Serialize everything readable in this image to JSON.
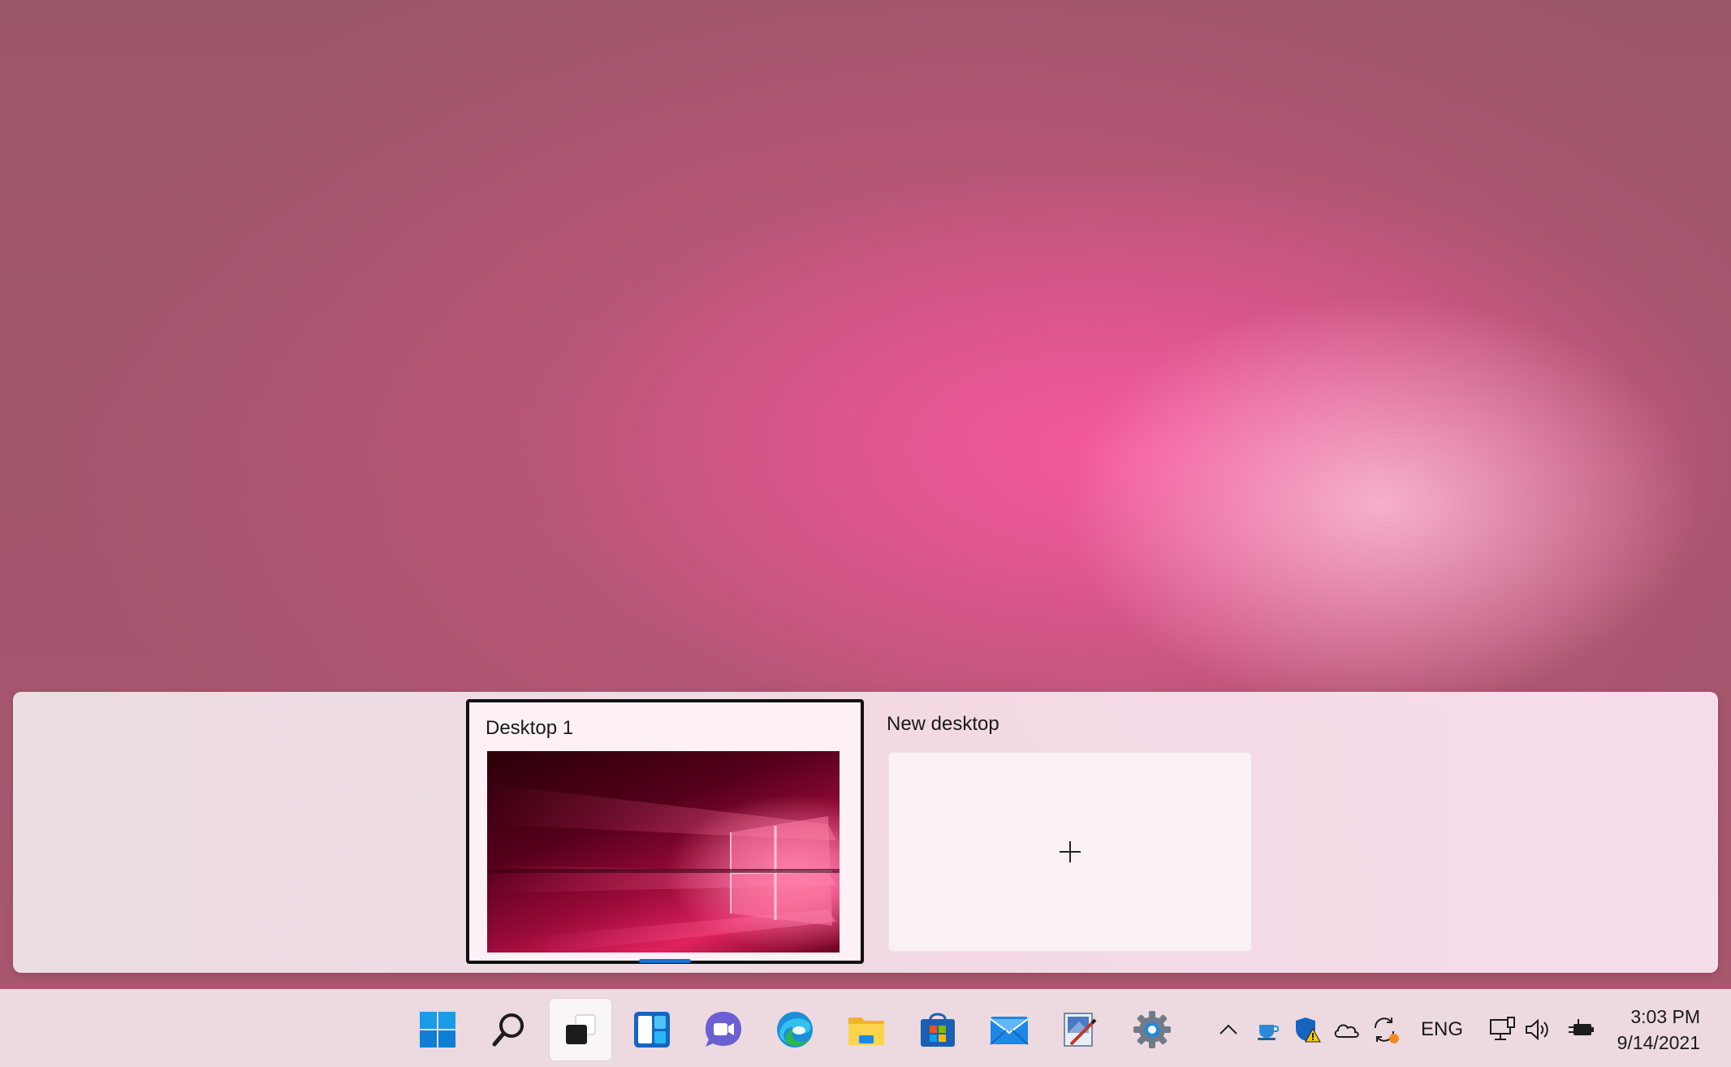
{
  "task_view": {
    "desktops": [
      {
        "label": "Desktop 1",
        "active": true
      },
      {
        "label": "New desktop",
        "add_icon": "plus-icon"
      }
    ]
  },
  "taskbar": {
    "apps": [
      {
        "name": "Start",
        "icon": "windows-logo-icon"
      },
      {
        "name": "Search",
        "icon": "search-icon"
      },
      {
        "name": "Task View",
        "icon": "task-view-icon",
        "active": true
      },
      {
        "name": "Widgets",
        "icon": "widgets-icon"
      },
      {
        "name": "Chat",
        "icon": "teams-chat-icon"
      },
      {
        "name": "Microsoft Edge",
        "icon": "edge-icon"
      },
      {
        "name": "File Explorer",
        "icon": "file-explorer-icon"
      },
      {
        "name": "Microsoft Store",
        "icon": "store-icon"
      },
      {
        "name": "Mail",
        "icon": "mail-icon"
      },
      {
        "name": "Paint",
        "icon": "paint-icon"
      },
      {
        "name": "Settings",
        "icon": "settings-gear-icon"
      }
    ],
    "tray": {
      "icons": [
        "chevron-up-icon",
        "coffee-cup-icon",
        "defender-shield-warning-icon",
        "onedrive-cloud-icon",
        "sync-icon",
        "network-icon",
        "volume-icon",
        "battery-plug-icon"
      ],
      "language": "ENG",
      "time": "3:03 PM",
      "date": "9/14/2021"
    }
  },
  "colors": {
    "accent": "#1a6fd1",
    "wallpaper": "#d9508a"
  }
}
